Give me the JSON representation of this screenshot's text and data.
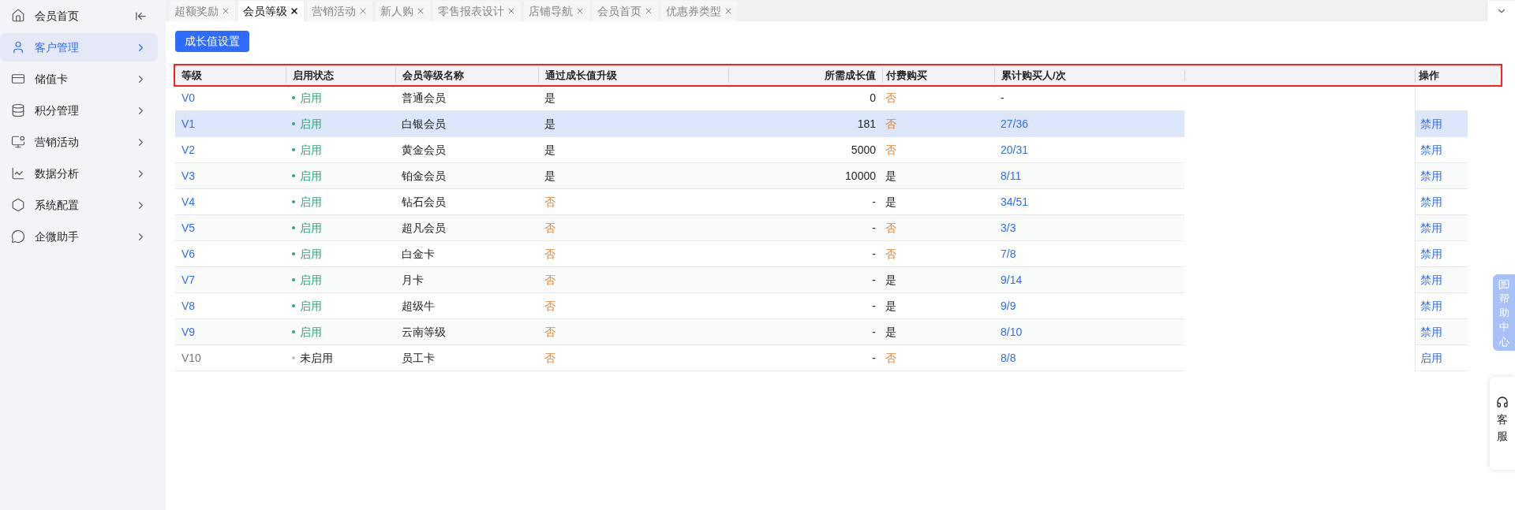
{
  "sidebar": {
    "items": [
      {
        "label": "会员首页",
        "selected": false,
        "kind": "home"
      },
      {
        "label": "客户管理",
        "selected": true,
        "kind": "group"
      },
      {
        "label": "储值卡",
        "selected": false,
        "kind": "group"
      },
      {
        "label": "积分管理",
        "selected": false,
        "kind": "group"
      },
      {
        "label": "营销活动",
        "selected": false,
        "kind": "group"
      },
      {
        "label": "数据分析",
        "selected": false,
        "kind": "group"
      },
      {
        "label": "系统配置",
        "selected": false,
        "kind": "group"
      },
      {
        "label": "企微助手",
        "selected": false,
        "kind": "group"
      }
    ]
  },
  "tabs": [
    {
      "label": "超额奖励",
      "selected": false
    },
    {
      "label": "会员等级",
      "selected": true
    },
    {
      "label": "营销活动",
      "selected": false
    },
    {
      "label": "新人购",
      "selected": false
    },
    {
      "label": "零售报表设计",
      "selected": false
    },
    {
      "label": "店铺导航",
      "selected": false
    },
    {
      "label": "会员首页",
      "selected": false
    },
    {
      "label": "优惠券类型",
      "selected": false
    }
  ],
  "toolbar": {
    "button": "成长值设置"
  },
  "table": {
    "columns": [
      "等级",
      "启用状态",
      "会员等级名称",
      "通过成长值升级",
      "所需成长值",
      "付费购买",
      "累计购买人/次",
      "操作"
    ],
    "rows": [
      {
        "level": "V0",
        "status": "启用",
        "enabled": true,
        "name": "普通会员",
        "by_growth": {
          "text": "是",
          "warn": false
        },
        "growth": "0",
        "paid": {
          "text": "否",
          "warn": true
        },
        "buyers": {
          "text": "-",
          "link": false
        },
        "selected": false
      },
      {
        "level": "V1",
        "status": "启用",
        "enabled": true,
        "name": "白银会员",
        "by_growth": {
          "text": "是",
          "warn": false
        },
        "growth": "181",
        "paid": {
          "text": "否",
          "warn": true
        },
        "buyers": {
          "text": "27/36",
          "link": true
        },
        "action": "禁用",
        "selected": true
      },
      {
        "level": "V2",
        "status": "启用",
        "enabled": true,
        "name": "黄金会员",
        "by_growth": {
          "text": "是",
          "warn": false
        },
        "growth": "5000",
        "paid": {
          "text": "否",
          "warn": true
        },
        "buyers": {
          "text": "20/31",
          "link": true
        },
        "action": "禁用",
        "selected": false
      },
      {
        "level": "V3",
        "status": "启用",
        "enabled": true,
        "name": "铂金会员",
        "by_growth": {
          "text": "是",
          "warn": false
        },
        "growth": "10000",
        "paid": {
          "text": "是",
          "warn": false
        },
        "buyers": {
          "text": "8/11",
          "link": true
        },
        "action": "禁用",
        "selected": false
      },
      {
        "level": "V4",
        "status": "启用",
        "enabled": true,
        "name": "钻石会员",
        "by_growth": {
          "text": "否",
          "warn": true
        },
        "growth": "-",
        "paid": {
          "text": "是",
          "warn": false
        },
        "buyers": {
          "text": "34/51",
          "link": true
        },
        "action": "禁用",
        "selected": false
      },
      {
        "level": "V5",
        "status": "启用",
        "enabled": true,
        "name": "超凡会员",
        "by_growth": {
          "text": "否",
          "warn": true
        },
        "growth": "-",
        "paid": {
          "text": "否",
          "warn": true
        },
        "buyers": {
          "text": "3/3",
          "link": true
        },
        "action": "禁用",
        "selected": false
      },
      {
        "level": "V6",
        "status": "启用",
        "enabled": true,
        "name": "白金卡",
        "by_growth": {
          "text": "否",
          "warn": true
        },
        "growth": "-",
        "paid": {
          "text": "否",
          "warn": true
        },
        "buyers": {
          "text": "7/8",
          "link": true
        },
        "action": "禁用",
        "selected": false
      },
      {
        "level": "V7",
        "status": "启用",
        "enabled": true,
        "name": "月卡",
        "by_growth": {
          "text": "否",
          "warn": true
        },
        "growth": "-",
        "paid": {
          "text": "是",
          "warn": false
        },
        "buyers": {
          "text": "9/14",
          "link": true
        },
        "action": "禁用",
        "selected": false
      },
      {
        "level": "V8",
        "status": "启用",
        "enabled": true,
        "name": "超级牛",
        "by_growth": {
          "text": "否",
          "warn": true
        },
        "growth": "-",
        "paid": {
          "text": "是",
          "warn": false
        },
        "buyers": {
          "text": "9/9",
          "link": true
        },
        "action": "禁用",
        "selected": false
      },
      {
        "level": "V9",
        "status": "启用",
        "enabled": true,
        "name": "云南等级",
        "by_growth": {
          "text": "否",
          "warn": true
        },
        "growth": "-",
        "paid": {
          "text": "是",
          "warn": false
        },
        "buyers": {
          "text": "8/10",
          "link": true
        },
        "action": "禁用",
        "selected": false
      },
      {
        "level": "V10",
        "status": "未启用",
        "enabled": false,
        "name": "员工卡",
        "by_growth": {
          "text": "否",
          "warn": true
        },
        "growth": "-",
        "paid": {
          "text": "否",
          "warn": true
        },
        "buyers": {
          "text": "8/8",
          "link": true
        },
        "action": "启用",
        "selected": false
      }
    ]
  },
  "float": {
    "help": "帮助中心",
    "service": "客服"
  }
}
